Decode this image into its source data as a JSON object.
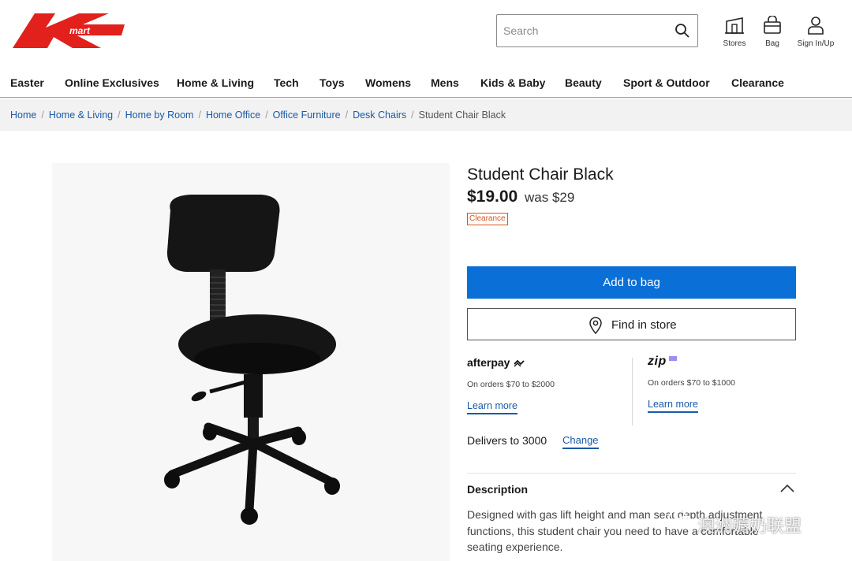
{
  "brand": {
    "name": "Kmart",
    "accent": "#e2201c"
  },
  "search": {
    "placeholder": "Search"
  },
  "header_actions": [
    {
      "label": "Stores",
      "icon": "store-icon"
    },
    {
      "label": "Bag",
      "icon": "bag-icon"
    },
    {
      "label": "Sign In/Up",
      "icon": "user-icon"
    }
  ],
  "nav": [
    "Easter",
    "Online Exclusives",
    "Home & Living",
    "Tech",
    "Toys",
    "Womens",
    "Mens",
    "Kids & Baby",
    "Beauty",
    "Sport & Outdoor",
    "Clearance"
  ],
  "breadcrumb": {
    "links": [
      "Home",
      "Home & Living",
      "Home by Room",
      "Home Office",
      "Office Furniture",
      "Desk Chairs"
    ],
    "current": "Student Chair Black"
  },
  "product": {
    "title": "Student Chair Black",
    "price": "$19.00",
    "was": "was $29",
    "badge": "Clearance",
    "add_to_bag": "Add to bag",
    "find_in_store": "Find in store"
  },
  "payments": [
    {
      "logo": "afterpay",
      "note": "On orders $70 to $2000",
      "link": "Learn more"
    },
    {
      "logo": "zip",
      "note": "On orders $70 to $1000",
      "link": "Learn more"
    }
  ],
  "delivery": {
    "text": "Delivers to 3000",
    "change": "Change"
  },
  "description": {
    "heading": "Description",
    "text": "Designed with gas lift height and man     seat depth adjustment functions, this student chair          you need to have a comfortable seating experience."
  },
  "watermark": "澳洲薅奶联盟",
  "colors": {
    "primary_button": "#0a6fd6",
    "link": "#1a5aa6",
    "clearance": "#d9541e"
  }
}
